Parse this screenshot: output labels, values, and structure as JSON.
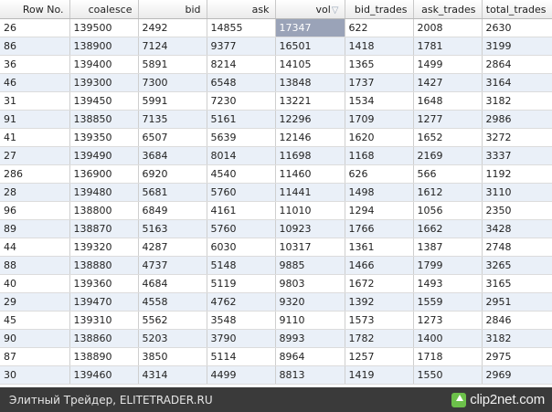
{
  "table": {
    "columns": [
      "Row No.",
      "coalesce",
      "bid",
      "ask",
      "vol",
      "bid_trades",
      "ask_trades",
      "total_trades"
    ],
    "sorted_column": "vol",
    "sort_indicator": "▽",
    "rows": [
      [
        "26",
        "139500",
        "2492",
        "14855",
        "17347",
        "622",
        "2008",
        "2630"
      ],
      [
        "86",
        "138900",
        "7124",
        "9377",
        "16501",
        "1418",
        "1781",
        "3199"
      ],
      [
        "36",
        "139400",
        "5891",
        "8214",
        "14105",
        "1365",
        "1499",
        "2864"
      ],
      [
        "46",
        "139300",
        "7300",
        "6548",
        "13848",
        "1737",
        "1427",
        "3164"
      ],
      [
        "31",
        "139450",
        "5991",
        "7230",
        "13221",
        "1534",
        "1648",
        "3182"
      ],
      [
        "91",
        "138850",
        "7135",
        "5161",
        "12296",
        "1709",
        "1277",
        "2986"
      ],
      [
        "41",
        "139350",
        "6507",
        "5639",
        "12146",
        "1620",
        "1652",
        "3272"
      ],
      [
        "27",
        "139490",
        "3684",
        "8014",
        "11698",
        "1168",
        "2169",
        "3337"
      ],
      [
        "286",
        "136900",
        "6920",
        "4540",
        "11460",
        "626",
        "566",
        "1192"
      ],
      [
        "28",
        "139480",
        "5681",
        "5760",
        "11441",
        "1498",
        "1612",
        "3110"
      ],
      [
        "96",
        "138800",
        "6849",
        "4161",
        "11010",
        "1294",
        "1056",
        "2350"
      ],
      [
        "89",
        "138870",
        "5163",
        "5760",
        "10923",
        "1766",
        "1662",
        "3428"
      ],
      [
        "44",
        "139320",
        "4287",
        "6030",
        "10317",
        "1361",
        "1387",
        "2748"
      ],
      [
        "88",
        "138880",
        "4737",
        "5148",
        "9885",
        "1466",
        "1799",
        "3265"
      ],
      [
        "40",
        "139360",
        "4684",
        "5119",
        "9803",
        "1672",
        "1493",
        "3165"
      ],
      [
        "29",
        "139470",
        "4558",
        "4762",
        "9320",
        "1392",
        "1559",
        "2951"
      ],
      [
        "45",
        "139310",
        "5562",
        "3548",
        "9110",
        "1573",
        "1273",
        "2846"
      ],
      [
        "90",
        "138860",
        "5203",
        "3790",
        "8993",
        "1782",
        "1400",
        "3182"
      ],
      [
        "87",
        "138890",
        "3850",
        "5114",
        "8964",
        "1257",
        "1718",
        "2975"
      ],
      [
        "30",
        "139460",
        "4314",
        "4499",
        "8813",
        "1419",
        "1550",
        "2969"
      ]
    ],
    "selected_cell": {
      "row": 0,
      "col": 4
    }
  },
  "footer": {
    "caption": "Элитный Трейдер, ELITETRADER.RU",
    "brand": "clip2net.com",
    "brand_icon": "clip2net-logo-icon"
  }
}
